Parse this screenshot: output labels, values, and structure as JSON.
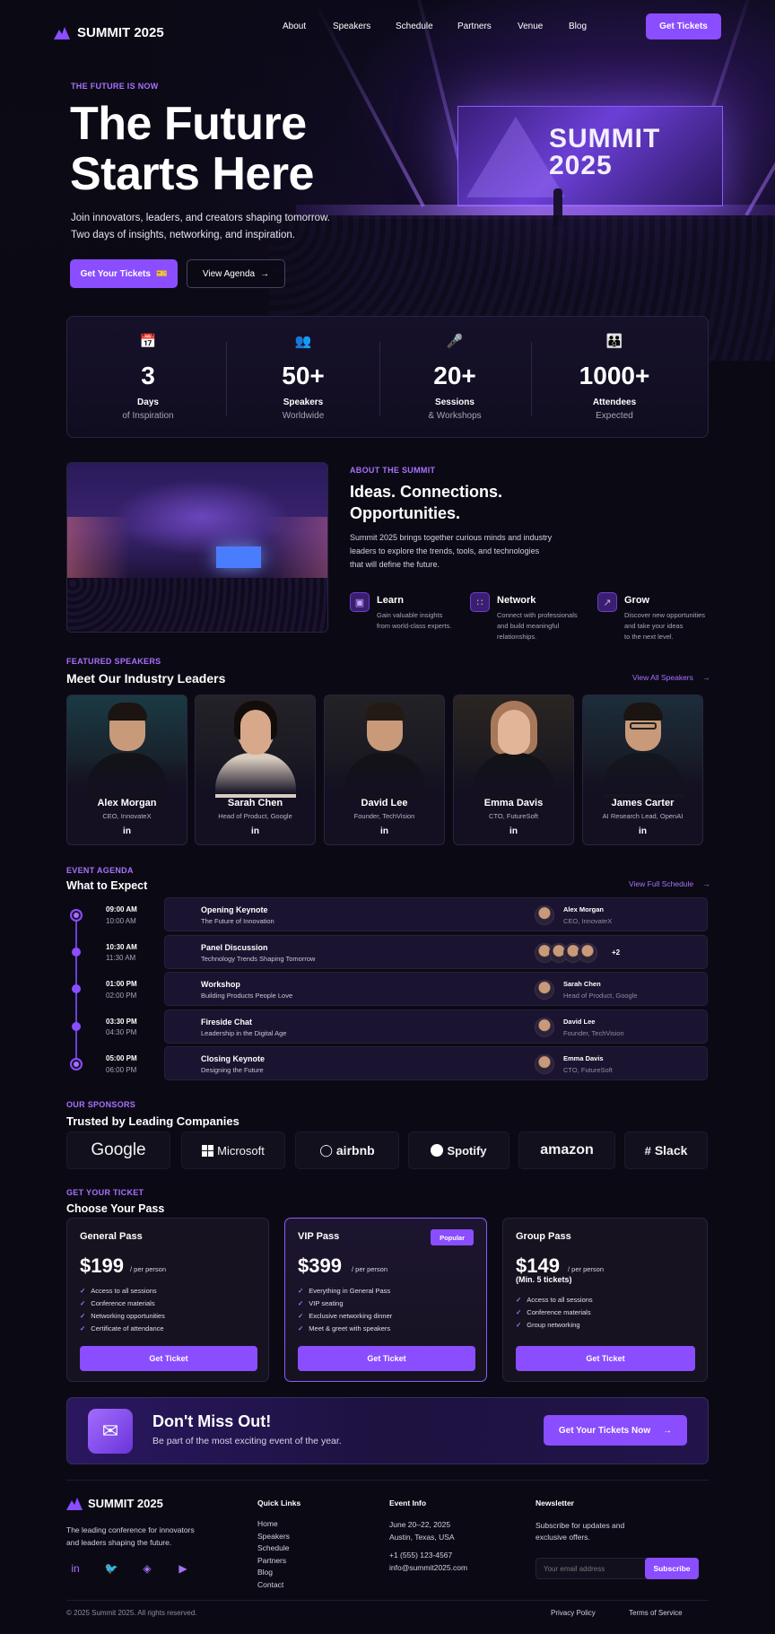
{
  "brand": {
    "name": "SUMMIT 2025",
    "accent": "#8a4dff"
  },
  "nav": {
    "links": [
      "About",
      "Speakers",
      "Schedule",
      "Partners",
      "Venue",
      "Blog"
    ],
    "cta": "Get Tickets"
  },
  "hero": {
    "kicker": "THE FUTURE IS NOW",
    "title_line1": "The Future",
    "title_line2": "Starts Here",
    "sub_line1": "Join innovators, leaders, and creators shaping tomorrow.",
    "sub_line2": "Two days of insights, networking, and inspiration.",
    "primary_button": "Get Your Tickets",
    "secondary_button": "View Agenda",
    "screen_line1": "SUMMIT",
    "screen_line2": "2025"
  },
  "stats": [
    {
      "icon": "calendar-icon",
      "value": "3",
      "label": "Days",
      "sub": "of Inspiration"
    },
    {
      "icon": "users-icon",
      "value": "50+",
      "label": "Speakers",
      "sub": "Worldwide"
    },
    {
      "icon": "microphone-icon",
      "value": "20+",
      "label": "Sessions",
      "sub": "& Workshops"
    },
    {
      "icon": "group-icon",
      "value": "1000+",
      "label": "Attendees",
      "sub": "Expected"
    }
  ],
  "about": {
    "kicker": "ABOUT THE SUMMIT",
    "title_line1": "Ideas. Connections.",
    "title_line2": "Opportunities.",
    "body_line1": "Summit 2025 brings together curious minds and industry",
    "body_line2": "leaders to explore the trends, tools, and technologies",
    "body_line3": "that will define the future.",
    "features": [
      {
        "title": "Learn",
        "line1": "Gain valuable insights",
        "line2": "from world-class experts.",
        "line3": ""
      },
      {
        "title": "Network",
        "line1": "Connect with professionals",
        "line2": "and build meaningful",
        "line3": "relationships."
      },
      {
        "title": "Grow",
        "line1": "Discover new opportunities",
        "line2": "and take your ideas",
        "line3": "to the next level."
      }
    ]
  },
  "speakers": {
    "kicker": "FEATURED SPEAKERS",
    "title": "Meet Our Industry Leaders",
    "view_all": "View All Speakers",
    "list": [
      {
        "name": "Alex Morgan",
        "role": "CEO, InnovateX"
      },
      {
        "name": "Sarah Chen",
        "role": "Head of Product, Google"
      },
      {
        "name": "David Lee",
        "role": "Founder, TechVision"
      },
      {
        "name": "Emma Davis",
        "role": "CTO, FutureSoft"
      },
      {
        "name": "James Carter",
        "role": "AI Research Lead, OpenAI"
      }
    ],
    "linkedin": "in"
  },
  "agenda": {
    "kicker": "EVENT AGENDA",
    "title": "What to Expect",
    "view_all": "View Full Schedule",
    "items": [
      {
        "start": "09:00 AM",
        "end": "10:00 AM",
        "title": "Opening Keynote",
        "desc": "The Future of Innovation",
        "speaker": "Alex Morgan",
        "speaker_role": "CEO, InnovateX"
      },
      {
        "start": "10:30 AM",
        "end": "11:30 AM",
        "title": "Panel Discussion",
        "desc": "Technology Trends Shaping Tomorrow",
        "speaker": "",
        "speaker_role": "",
        "more": "+2"
      },
      {
        "start": "01:00 PM",
        "end": "02:00 PM",
        "title": "Workshop",
        "desc": "Building Products People Love",
        "speaker": "Sarah Chen",
        "speaker_role": "Head of Product, Google"
      },
      {
        "start": "03:30 PM",
        "end": "04:30 PM",
        "title": "Fireside Chat",
        "desc": "Leadership in the Digital Age",
        "speaker": "David Lee",
        "speaker_role": "Founder, TechVision"
      },
      {
        "start": "05:00 PM",
        "end": "06:00 PM",
        "title": "Closing Keynote",
        "desc": "Designing the Future",
        "speaker": "Emma Davis",
        "speaker_role": "CTO, FutureSoft"
      }
    ]
  },
  "sponsors": {
    "kicker": "OUR SPONSORS",
    "title": "Trusted by Leading Companies",
    "list": [
      "Google",
      "Microsoft",
      "airbnb",
      "Spotify",
      "amazon",
      "Slack"
    ]
  },
  "pricing": {
    "kicker": "GET YOUR TICKET",
    "title": "Choose Your Pass",
    "plans": [
      {
        "name": "General Pass",
        "price": "$199",
        "unit": "/ per person",
        "note": "",
        "features": [
          "Access to all sessions",
          "Conference materials",
          "Networking opportunities",
          "Certificate of attendance"
        ],
        "button": "Get Ticket"
      },
      {
        "name": "VIP Pass",
        "price": "$399",
        "unit": "/ per person",
        "note": "",
        "badge": "Popular",
        "features": [
          "Everything in General Pass",
          "VIP seating",
          "Exclusive networking dinner",
          "Meet & greet with speakers"
        ],
        "button": "Get Ticket"
      },
      {
        "name": "Group Pass",
        "price": "$149",
        "unit": "/ per person",
        "note": "(Min. 5 tickets)",
        "features": [
          "Access to all sessions",
          "Conference materials",
          "Group networking"
        ],
        "button": "Get Ticket"
      }
    ]
  },
  "cta": {
    "title": "Don't Miss Out!",
    "sub": "Be part of the most exciting event of the year.",
    "button": "Get Your Tickets Now"
  },
  "footer": {
    "tagline_line1": "The leading conference for innovators",
    "tagline_line2": "and leaders shaping the future.",
    "quick_links_title": "Quick Links",
    "quick_links": [
      "Home",
      "Speakers",
      "Schedule",
      "Partners",
      "Blog",
      "Contact"
    ],
    "event_info_title": "Event Info",
    "event_dates": "June 20–22, 2025",
    "event_location": "Austin, Texas, USA",
    "event_phone": "+1 (555) 123-4567",
    "event_email": "info@summit2025.com",
    "newsletter_title": "Newsletter",
    "newsletter_line1": "Subscribe for updates and",
    "newsletter_line2": "exclusive offers.",
    "email_placeholder": "Your email address",
    "subscribe": "Subscribe",
    "copyright": "© 2025 Summit 2025. All rights reserved.",
    "privacy": "Privacy Policy",
    "terms": "Terms of Service",
    "socials": [
      "linkedin-icon",
      "twitter-icon",
      "instagram-icon",
      "youtube-icon"
    ]
  }
}
